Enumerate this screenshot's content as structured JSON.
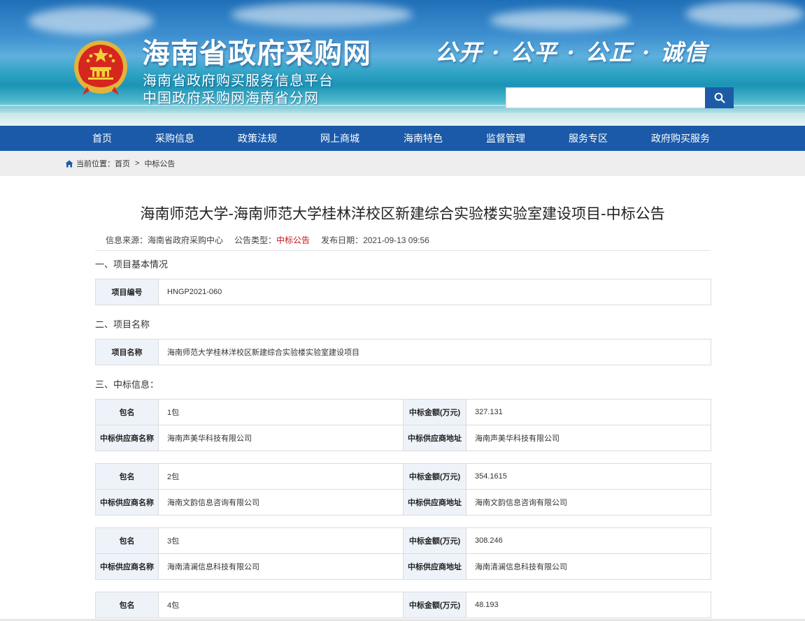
{
  "header": {
    "site_title": "海南省政府采购网",
    "subtitle1": "海南省政府购买服务信息平台",
    "subtitle2": "中国政府采购网海南省分网",
    "slogan": "公开 · 公平 · 公正 · 诚信",
    "search": {
      "placeholder": "",
      "value": ""
    }
  },
  "nav": {
    "items": [
      "首页",
      "采购信息",
      "政策法规",
      "网上商城",
      "海南特色",
      "监督管理",
      "服务专区",
      "政府购买服务"
    ]
  },
  "breadcrumb": {
    "prefix": "当前位置：",
    "items": [
      "首页",
      "中标公告"
    ],
    "separator": ">"
  },
  "article": {
    "title": "海南师范大学-海南师范大学桂林洋校区新建综合实验楼实验室建设项目-中标公告",
    "meta": {
      "source_label": "信息来源：",
      "source": "海南省政府采购中心",
      "type_label": "公告类型：",
      "type": "中标公告",
      "date_label": "发布日期：",
      "date": "2021-09-13 09:56"
    },
    "section1": {
      "heading": "一、项目基本情况",
      "label": "项目编号",
      "value": "HNGP2021-060"
    },
    "section2": {
      "heading": "二、项目名称",
      "label": "项目名称",
      "value": "海南师范大学桂林洋校区新建综合实验楼实验室建设项目"
    },
    "section3": {
      "heading": "三、中标信息：",
      "labels": {
        "package": "包名",
        "amount": "中标金额(万元)",
        "supplier_name": "中标供应商名称",
        "supplier_address": "中标供应商地址"
      },
      "packages": [
        {
          "package": "1包",
          "amount": "327.131",
          "supplier_name": "海南声美华科技有限公司",
          "supplier_address": "海南声美华科技有限公司"
        },
        {
          "package": "2包",
          "amount": "354.1615",
          "supplier_name": "海南文韵信息咨询有限公司",
          "supplier_address": "海南文韵信息咨询有限公司"
        },
        {
          "package": "3包",
          "amount": "308.246",
          "supplier_name": "海南清澜信息科技有限公司",
          "supplier_address": "海南清澜信息科技有限公司"
        },
        {
          "package": "4包",
          "amount": "48.193"
        }
      ]
    }
  },
  "colors": {
    "nav_bg": "#1a5aa8",
    "search_button": "#1d5ba6",
    "label_cell_bg": "#eef3f9",
    "highlight_red": "#c8161d"
  }
}
